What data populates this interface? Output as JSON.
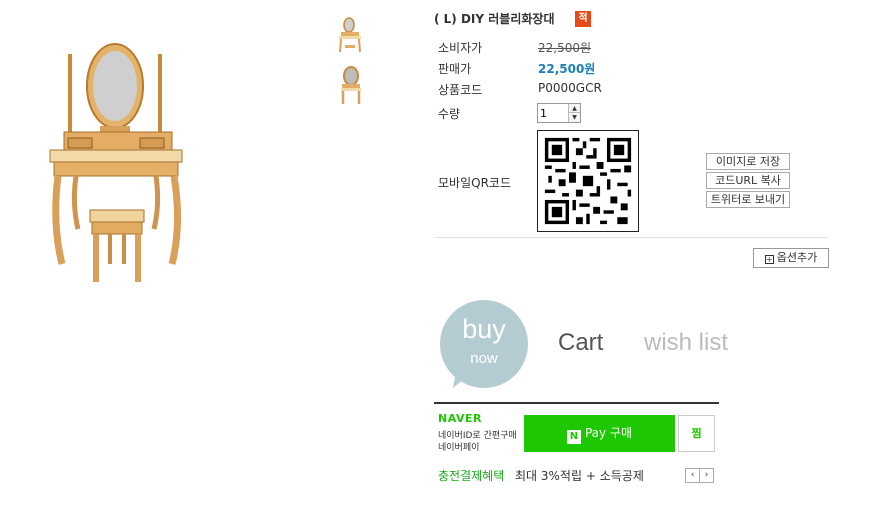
{
  "product": {
    "title": "( L) DIY 러블리화장대",
    "badge": "적"
  },
  "info": {
    "consumer_price_label": "소비자가",
    "consumer_price": "22,500원",
    "sale_price_label": "판매가",
    "sale_price": "22,500원",
    "code_label": "상품코드",
    "code": "P0000GCR",
    "quantity_label": "수량",
    "quantity": "1",
    "qr_label": "모바일QR코드"
  },
  "qr_actions": {
    "save_image": "이미지로 저장",
    "copy_url": "코드URL 복사",
    "send_twitter": "트위터로 보내기"
  },
  "option_button": {
    "icon": "plus-box-icon",
    "label": "옵션추가"
  },
  "actions": {
    "buy": "buy",
    "buy_sub": "now",
    "cart": "Cart",
    "wish": "wish list"
  },
  "naver": {
    "logo": "NAVER",
    "desc_line1": "네이버ID로 간편구매",
    "desc_line2": "네이버페이",
    "pay_icon": "N",
    "pay_label": "Pay 구매",
    "jjim_label": "찜"
  },
  "promo": {
    "highlight": "충전결제혜택",
    "text": "최대 3%적립 + 소득공제",
    "prev": "‹",
    "next": "›"
  },
  "colors": {
    "price_blue": "#1a7fb8",
    "badge_red": "#e64a19",
    "naver_green": "#1ec800",
    "buy_circle": "#b4ccd1"
  }
}
